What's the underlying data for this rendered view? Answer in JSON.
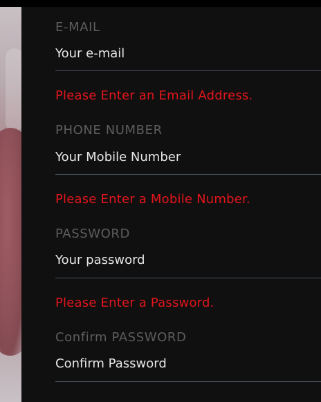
{
  "form": {
    "email": {
      "label": "E-MAIL",
      "placeholder": "Your e-mail",
      "error": "Please Enter an Email Address."
    },
    "phone": {
      "label": "PHONE NUMBER",
      "placeholder": "Your Mobile Number",
      "error": "Please Enter a Mobile Number."
    },
    "password": {
      "label": "PASSWORD",
      "placeholder": "Your password",
      "error": "Please Enter a Password."
    },
    "confirm": {
      "label": "Confirm PASSWORD",
      "placeholder": "Confirm Password"
    }
  },
  "colors": {
    "panel_bg": "#101010",
    "label": "#5d5d5d",
    "input_text": "#e6e6e6",
    "underline": "#4a5560",
    "error": "#e3151c"
  }
}
